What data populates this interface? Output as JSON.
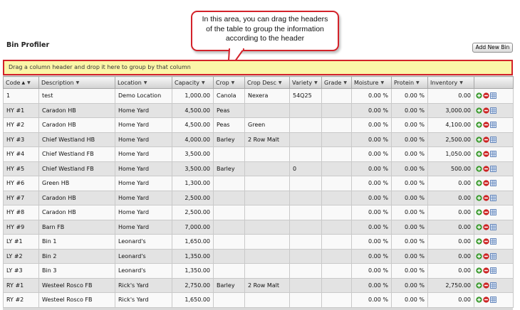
{
  "page": {
    "title": "Bin Profiler",
    "add_button": "Add New Bin"
  },
  "callout": {
    "lines": [
      "In this area, you can drag the headers",
      "of the table to group the information",
      "according to the header"
    ]
  },
  "group_panel": {
    "text": "Drag a column header and drop it here to group by that column"
  },
  "columns": [
    {
      "key": "code",
      "label": "Code",
      "sort": "▲"
    },
    {
      "key": "description",
      "label": "Description"
    },
    {
      "key": "location",
      "label": "Location"
    },
    {
      "key": "capacity",
      "label": "Capacity"
    },
    {
      "key": "crop",
      "label": "Crop"
    },
    {
      "key": "crop_desc",
      "label": "Crop Desc"
    },
    {
      "key": "variety",
      "label": "Variety"
    },
    {
      "key": "grade",
      "label": "Grade"
    },
    {
      "key": "moisture",
      "label": "Moisture"
    },
    {
      "key": "protein",
      "label": "Protein"
    },
    {
      "key": "inventory",
      "label": "Inventory"
    },
    {
      "key": "actions",
      "label": ""
    }
  ],
  "rows": [
    {
      "code": "1",
      "description": "test",
      "location": "Demo Location",
      "capacity": "1,000.00",
      "crop": "Canola",
      "crop_desc": "Nexera",
      "variety": "54Q25",
      "grade": "",
      "moisture": "0.00 %",
      "protein": "0.00 %",
      "inventory": "0.00"
    },
    {
      "code": "HY #1",
      "description": "Caradon HB",
      "location": "Home Yard",
      "capacity": "4,500.00",
      "crop": "Peas",
      "crop_desc": "",
      "variety": "",
      "grade": "",
      "moisture": "0.00 %",
      "protein": "0.00 %",
      "inventory": "3,000.00"
    },
    {
      "code": "HY #2",
      "description": "Caradon HB",
      "location": "Home Yard",
      "capacity": "4,500.00",
      "crop": "Peas",
      "crop_desc": "Green",
      "variety": "",
      "grade": "",
      "moisture": "0.00 %",
      "protein": "0.00 %",
      "inventory": "4,100.00"
    },
    {
      "code": "HY #3",
      "description": "Chief Westland HB",
      "location": "Home Yard",
      "capacity": "4,000.00",
      "crop": "Barley",
      "crop_desc": "2 Row Malt",
      "variety": "",
      "grade": "",
      "moisture": "0.00 %",
      "protein": "0.00 %",
      "inventory": "2,500.00"
    },
    {
      "code": "HY #4",
      "description": "Chief Westland FB",
      "location": "Home Yard",
      "capacity": "3,500.00",
      "crop": "",
      "crop_desc": "",
      "variety": "",
      "grade": "",
      "moisture": "0.00 %",
      "protein": "0.00 %",
      "inventory": "1,050.00"
    },
    {
      "code": "HY #5",
      "description": "Chief Westland FB",
      "location": "Home Yard",
      "capacity": "3,500.00",
      "crop": "Barley",
      "crop_desc": "",
      "variety": "0",
      "grade": "",
      "moisture": "0.00 %",
      "protein": "0.00 %",
      "inventory": "500.00"
    },
    {
      "code": "HY #6",
      "description": "Green HB",
      "location": "Home Yard",
      "capacity": "1,300.00",
      "crop": "",
      "crop_desc": "",
      "variety": "",
      "grade": "",
      "moisture": "0.00 %",
      "protein": "0.00 %",
      "inventory": "0.00"
    },
    {
      "code": "HY #7",
      "description": "Caradon HB",
      "location": "Home Yard",
      "capacity": "2,500.00",
      "crop": "",
      "crop_desc": "",
      "variety": "",
      "grade": "",
      "moisture": "0.00 %",
      "protein": "0.00 %",
      "inventory": "0.00"
    },
    {
      "code": "HY #8",
      "description": "Caradon HB",
      "location": "Home Yard",
      "capacity": "2,500.00",
      "crop": "",
      "crop_desc": "",
      "variety": "",
      "grade": "",
      "moisture": "0.00 %",
      "protein": "0.00 %",
      "inventory": "0.00"
    },
    {
      "code": "HY #9",
      "description": "Barn FB",
      "location": "Home Yard",
      "capacity": "7,000.00",
      "crop": "",
      "crop_desc": "",
      "variety": "",
      "grade": "",
      "moisture": "0.00 %",
      "protein": "0.00 %",
      "inventory": "0.00"
    },
    {
      "code": "LY #1",
      "description": "Bin 1",
      "location": "Leonard's",
      "capacity": "1,650.00",
      "crop": "",
      "crop_desc": "",
      "variety": "",
      "grade": "",
      "moisture": "0.00 %",
      "protein": "0.00 %",
      "inventory": "0.00"
    },
    {
      "code": "LY #2",
      "description": "Bin 2",
      "location": "Leonard's",
      "capacity": "1,350.00",
      "crop": "",
      "crop_desc": "",
      "variety": "",
      "grade": "",
      "moisture": "0.00 %",
      "protein": "0.00 %",
      "inventory": "0.00"
    },
    {
      "code": "LY #3",
      "description": "Bin 3",
      "location": "Leonard's",
      "capacity": "1,350.00",
      "crop": "",
      "crop_desc": "",
      "variety": "",
      "grade": "",
      "moisture": "0.00 %",
      "protein": "0.00 %",
      "inventory": "0.00"
    },
    {
      "code": "RY #1",
      "description": "Westeel Rosco FB",
      "location": "Rick's Yard",
      "capacity": "2,750.00",
      "crop": "Barley",
      "crop_desc": "2 Row Malt",
      "variety": "",
      "grade": "",
      "moisture": "0.00 %",
      "protein": "0.00 %",
      "inventory": "2,750.00"
    },
    {
      "code": "RY #2",
      "description": "Westeel Rosco FB",
      "location": "Rick's Yard",
      "capacity": "1,650.00",
      "crop": "",
      "crop_desc": "",
      "variety": "",
      "grade": "",
      "moisture": "0.00 %",
      "protein": "0.00 %",
      "inventory": "0.00"
    }
  ],
  "row_action_icons": [
    "add-icon",
    "delete-icon",
    "details-icon"
  ],
  "colors": {
    "callout_border": "#d3222a",
    "group_panel_bg": "#fbf6a8",
    "add_icon": "#3a9a2e",
    "delete_icon": "#cc2222",
    "details_icon": "#5a7fb8"
  }
}
